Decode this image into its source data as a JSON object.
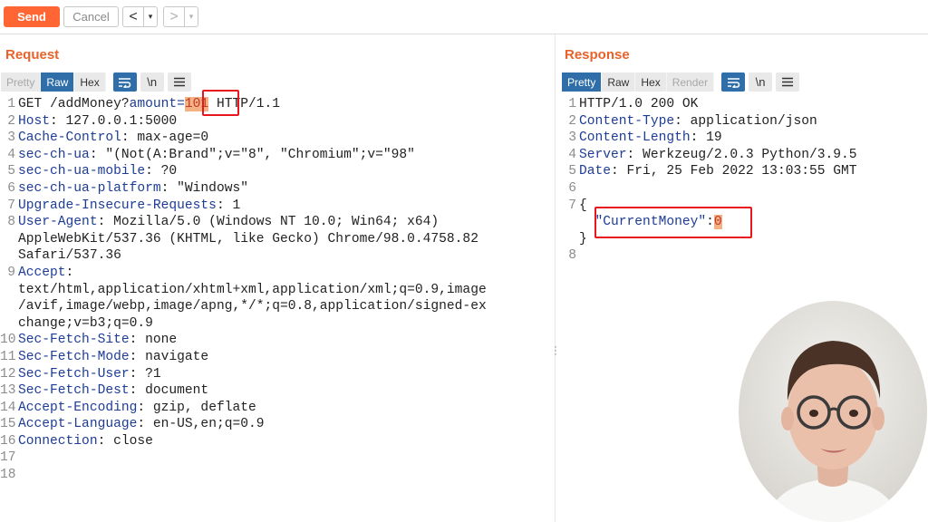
{
  "toolbar": {
    "send_label": "Send",
    "cancel_label": "Cancel",
    "back_arrow": "<",
    "forward_arrow": ">",
    "dropdown_glyph": "▾"
  },
  "request": {
    "title": "Request",
    "tabs": [
      "Pretty",
      "Raw",
      "Hex"
    ],
    "active_tab": "Raw",
    "newline_label": "\\n",
    "lines": [
      {
        "n": "1",
        "segments": [
          {
            "t": "GET /addMoney?",
            "c": "txt"
          },
          {
            "t": "amount=",
            "c": "k"
          },
          {
            "t": "101",
            "c": "hl"
          },
          {
            "t": " HTTP/1.1",
            "c": "txt"
          }
        ]
      },
      {
        "n": "2",
        "segments": [
          {
            "t": "Host",
            "c": "k"
          },
          {
            "t": ": 127.0.0.1:5000",
            "c": "txt"
          }
        ]
      },
      {
        "n": "3",
        "segments": [
          {
            "t": "Cache-Control",
            "c": "k"
          },
          {
            "t": ": max-age=0",
            "c": "txt"
          }
        ]
      },
      {
        "n": "4",
        "segments": [
          {
            "t": "sec-ch-ua",
            "c": "k"
          },
          {
            "t": ": \"(Not(A:Brand\";v=\"8\", \"Chromium\";v=\"98\"",
            "c": "txt"
          }
        ]
      },
      {
        "n": "5",
        "segments": [
          {
            "t": "sec-ch-ua-mobile",
            "c": "k"
          },
          {
            "t": ": ?0",
            "c": "txt"
          }
        ]
      },
      {
        "n": "6",
        "segments": [
          {
            "t": "sec-ch-ua-platform",
            "c": "k"
          },
          {
            "t": ": \"Windows\"",
            "c": "txt"
          }
        ]
      },
      {
        "n": "7",
        "segments": [
          {
            "t": "Upgrade-Insecure-Requests",
            "c": "k"
          },
          {
            "t": ": 1",
            "c": "txt"
          }
        ]
      },
      {
        "n": "8",
        "segments": [
          {
            "t": "User-Agent",
            "c": "k"
          },
          {
            "t": ": Mozilla/5.0 (Windows NT 10.0; Win64; x64)",
            "c": "txt"
          }
        ]
      },
      {
        "n": "",
        "segments": [
          {
            "t": "AppleWebKit/537.36 (KHTML, like Gecko) Chrome/98.0.4758.82",
            "c": "txt"
          }
        ]
      },
      {
        "n": "",
        "segments": [
          {
            "t": "Safari/537.36",
            "c": "txt"
          }
        ]
      },
      {
        "n": "9",
        "segments": [
          {
            "t": "Accept",
            "c": "k"
          },
          {
            "t": ":",
            "c": "txt"
          }
        ]
      },
      {
        "n": "",
        "segments": [
          {
            "t": "text/html,application/xhtml+xml,application/xml;q=0.9,image",
            "c": "txt"
          }
        ]
      },
      {
        "n": "",
        "segments": [
          {
            "t": "/avif,image/webp,image/apng,*/*;q=0.8,application/signed-ex",
            "c": "txt"
          }
        ]
      },
      {
        "n": "",
        "segments": [
          {
            "t": "change;v=b3;q=0.9",
            "c": "txt"
          }
        ]
      },
      {
        "n": "10",
        "segments": [
          {
            "t": "Sec-Fetch-Site",
            "c": "k"
          },
          {
            "t": ": none",
            "c": "txt"
          }
        ]
      },
      {
        "n": "11",
        "segments": [
          {
            "t": "Sec-Fetch-Mode",
            "c": "k"
          },
          {
            "t": ": navigate",
            "c": "txt"
          }
        ]
      },
      {
        "n": "12",
        "segments": [
          {
            "t": "Sec-Fetch-User",
            "c": "k"
          },
          {
            "t": ": ?1",
            "c": "txt"
          }
        ]
      },
      {
        "n": "13",
        "segments": [
          {
            "t": "Sec-Fetch-Dest",
            "c": "k"
          },
          {
            "t": ": document",
            "c": "txt"
          }
        ]
      },
      {
        "n": "14",
        "segments": [
          {
            "t": "Accept-Encoding",
            "c": "k"
          },
          {
            "t": ": gzip, deflate",
            "c": "txt"
          }
        ]
      },
      {
        "n": "15",
        "segments": [
          {
            "t": "Accept-Language",
            "c": "k"
          },
          {
            "t": ": en-US,en;q=0.9",
            "c": "txt"
          }
        ]
      },
      {
        "n": "16",
        "segments": [
          {
            "t": "Connection",
            "c": "k"
          },
          {
            "t": ": close",
            "c": "txt"
          }
        ]
      },
      {
        "n": "17",
        "segments": []
      },
      {
        "n": "18",
        "segments": []
      }
    ]
  },
  "response": {
    "title": "Response",
    "tabs": [
      "Pretty",
      "Raw",
      "Hex",
      "Render"
    ],
    "active_tab": "Pretty",
    "newline_label": "\\n",
    "lines": [
      {
        "n": "1",
        "segments": [
          {
            "t": "HTTP/1.0 200 OK",
            "c": "txt"
          }
        ]
      },
      {
        "n": "2",
        "segments": [
          {
            "t": "Content-Type",
            "c": "k"
          },
          {
            "t": ": application/json",
            "c": "txt"
          }
        ]
      },
      {
        "n": "3",
        "segments": [
          {
            "t": "Content-Length",
            "c": "k"
          },
          {
            "t": ": 19",
            "c": "txt"
          }
        ]
      },
      {
        "n": "4",
        "segments": [
          {
            "t": "Server",
            "c": "k"
          },
          {
            "t": ": Werkzeug/2.0.3 Python/3.9.5",
            "c": "txt"
          }
        ]
      },
      {
        "n": "5",
        "segments": [
          {
            "t": "Date",
            "c": "k"
          },
          {
            "t": ": Fri, 25 Feb 2022 13:03:55 GMT",
            "c": "txt"
          }
        ]
      },
      {
        "n": "6",
        "segments": []
      },
      {
        "n": "7",
        "segments": [
          {
            "t": "{",
            "c": "txt"
          }
        ]
      },
      {
        "n": "",
        "segments": [
          {
            "t": "  \"CurrentMoney\"",
            "c": "str"
          },
          {
            "t": ":",
            "c": "txt"
          },
          {
            "t": "0",
            "c": "hl"
          }
        ]
      },
      {
        "n": "",
        "segments": [
          {
            "t": "}",
            "c": "txt"
          }
        ]
      },
      {
        "n": "8",
        "segments": []
      }
    ]
  },
  "colors": {
    "accent": "#e8622a",
    "send_button": "#ff6633",
    "active_tab": "#2f6ea8",
    "highlight_box": "#e8171e"
  },
  "icons": {
    "wrap": "word-wrap-icon",
    "newline": "newline-icon",
    "menu": "hamburger-menu-icon",
    "more": "vertical-dots-icon"
  }
}
